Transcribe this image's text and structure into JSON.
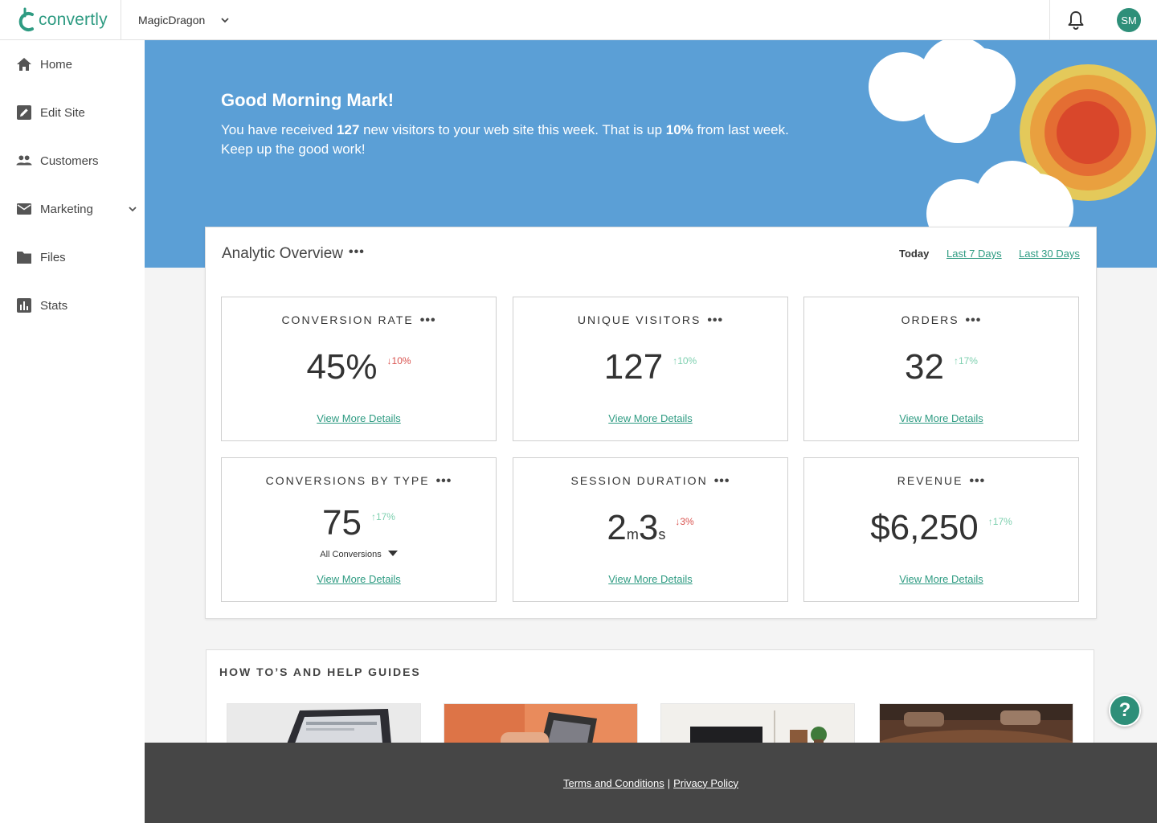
{
  "topbar": {
    "logo_text": "convertly",
    "site_name": "MagicDragon",
    "avatar_initials": "SM"
  },
  "sidebar": {
    "items": [
      {
        "label": "Home",
        "icon": "home-icon"
      },
      {
        "label": "Edit Site",
        "icon": "edit-icon"
      },
      {
        "label": "Customers",
        "icon": "people-icon"
      },
      {
        "label": "Marketing",
        "icon": "mail-icon"
      },
      {
        "label": "Files",
        "icon": "folder-icon"
      },
      {
        "label": "Stats",
        "icon": "bar-chart-icon"
      }
    ]
  },
  "hero": {
    "greeting": "Good Morning Mark!",
    "text_1": "You have received ",
    "visitors": "127",
    "text_2": " new visitors to your web site this week. That is up ",
    "percent": "10%",
    "text_3": " from last week.",
    "text_4": "Keep up the good work!"
  },
  "analytics": {
    "title": "Analytic Overview",
    "more": "•••",
    "ranges": {
      "today": "Today",
      "last7": "Last 7 Days",
      "last30": "Last 30 Days"
    },
    "link_label": "View More Details",
    "cards": {
      "conversion_rate": {
        "title": "CONVERSION RATE",
        "value": "45%",
        "delta": "↓10%"
      },
      "unique_visitors": {
        "title": "UNIQUE VISITORS",
        "value": "127",
        "delta": "↑10%"
      },
      "orders": {
        "title": "ORDERS",
        "value": "32",
        "delta": "↑17%"
      },
      "conversions_by_type": {
        "title": "CONVERSIONS BY TYPE",
        "value": "75",
        "delta": "↑17%",
        "select": "All Conversions"
      },
      "session_duration": {
        "title": "SESSION DURATION",
        "minutes": "2",
        "minutes_unit": "m",
        "seconds": "3",
        "seconds_unit": "s",
        "delta": "↓3%"
      },
      "revenue": {
        "title": "REVENUE",
        "value": "$6,250",
        "delta": "↑17%"
      }
    }
  },
  "guides": {
    "title": "HOW TO’S AND HELP GUIDES"
  },
  "footer": {
    "terms": "Terms and Conditions",
    "separator": "|",
    "privacy": "Privacy Policy"
  },
  "help": {
    "label": "?"
  },
  "colors": {
    "brand": "#2e9b82",
    "hero_bg": "#5b9fd6",
    "down": "#d9534f",
    "up": "#7fd0b0",
    "footer_bg": "#464646"
  }
}
